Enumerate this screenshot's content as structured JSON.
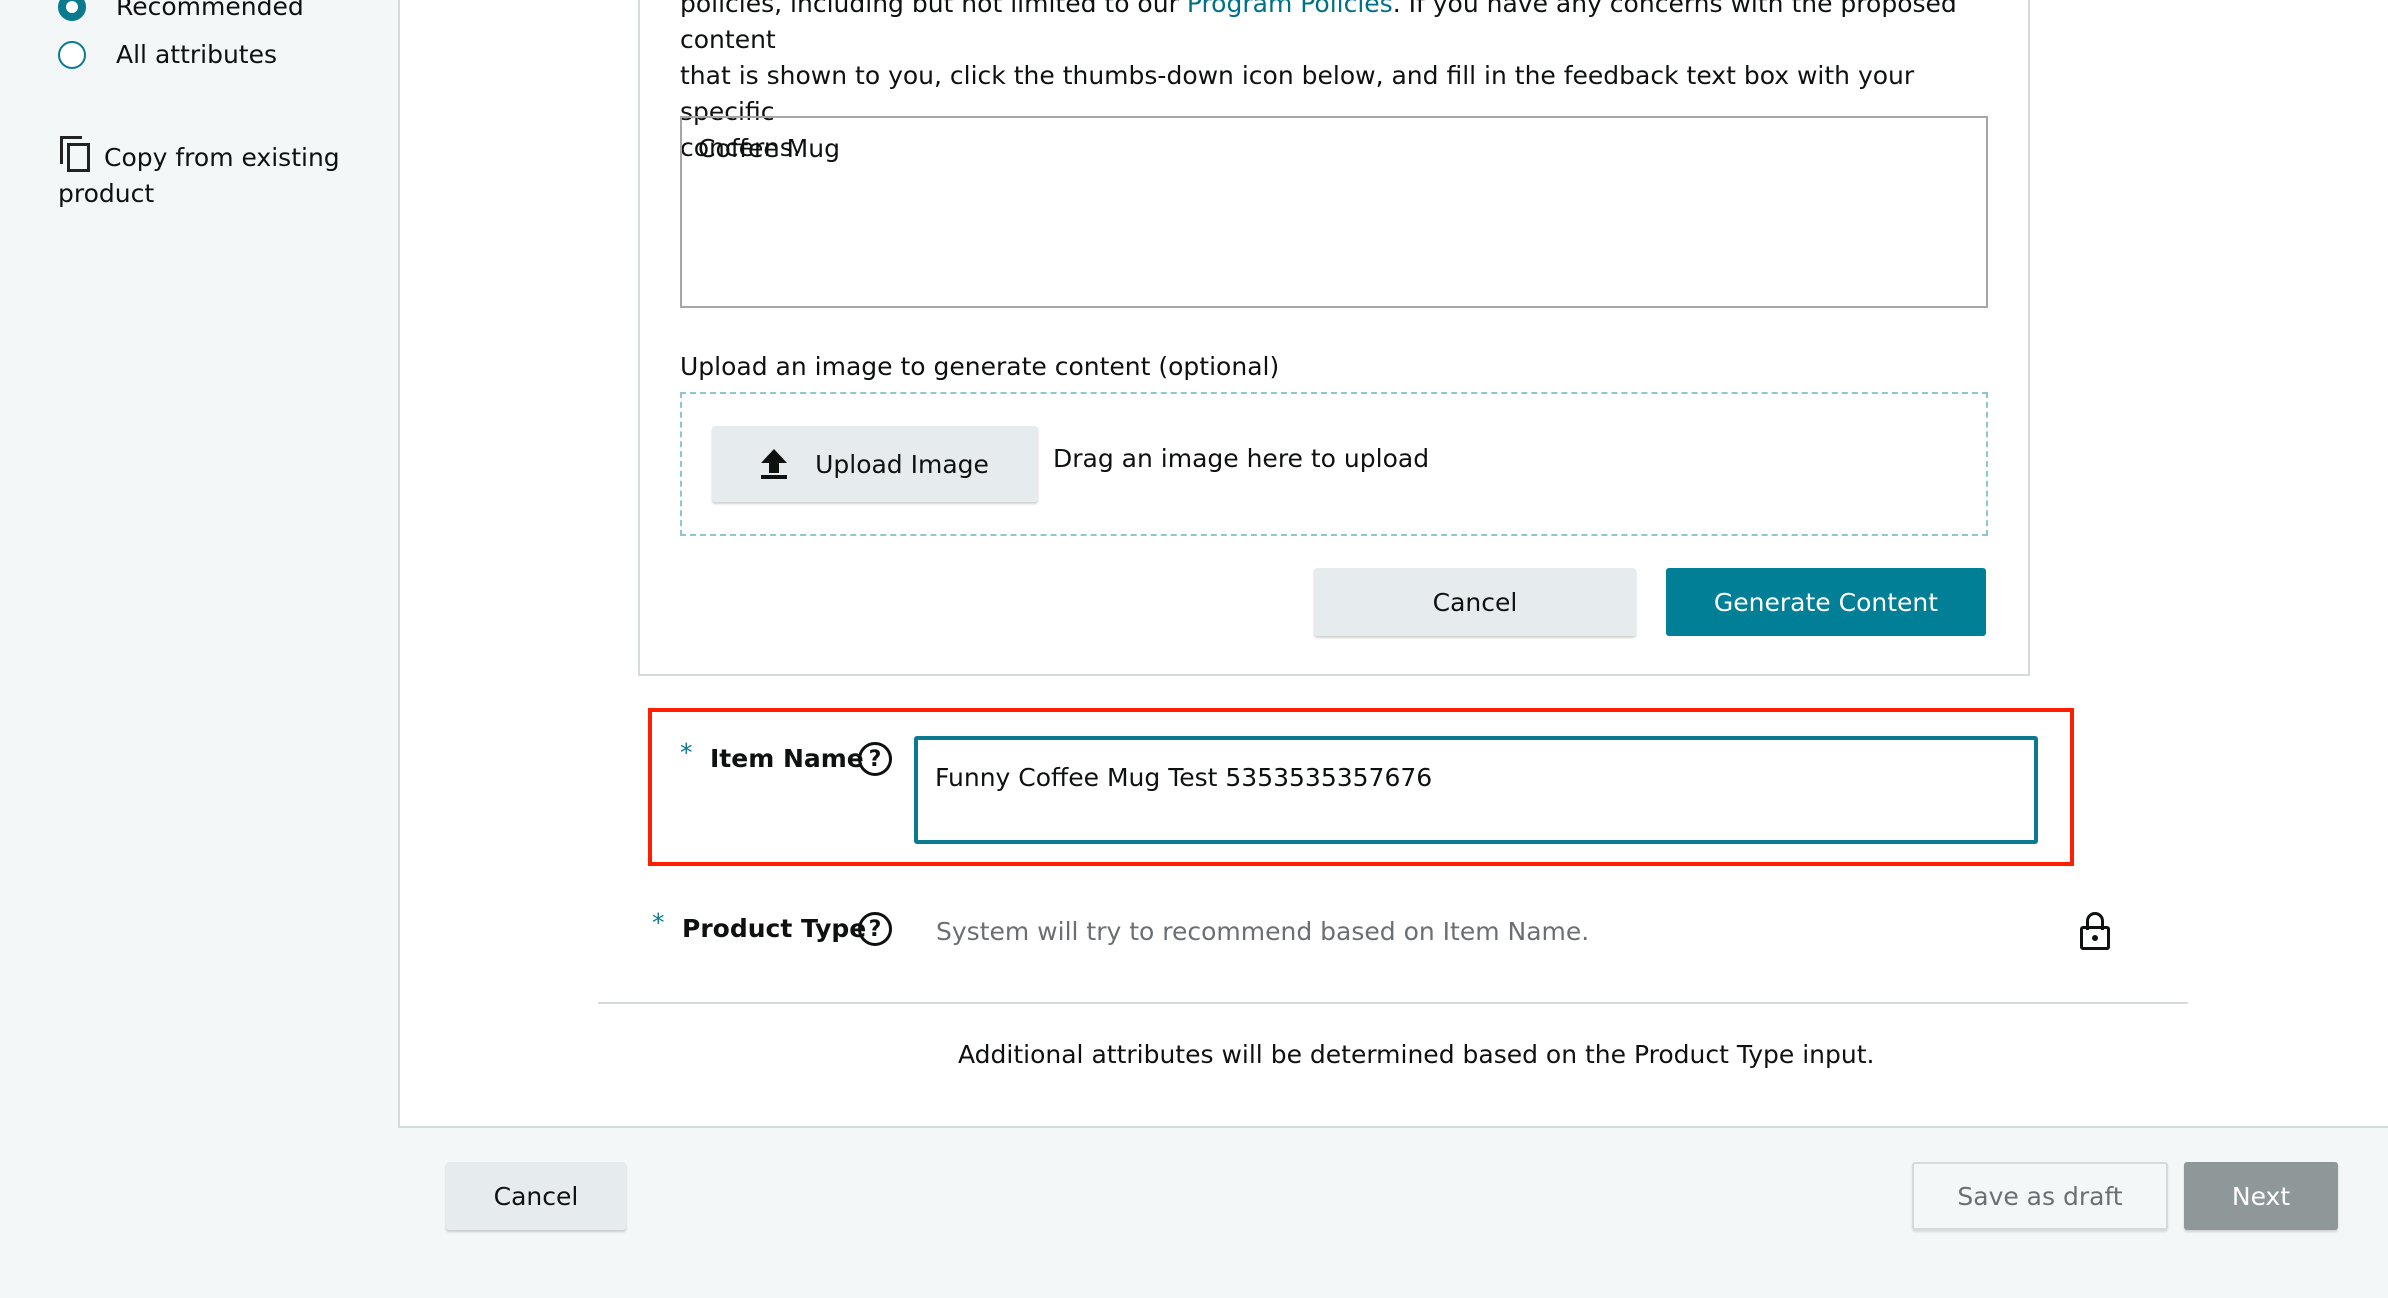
{
  "sidebar": {
    "view_options": [
      {
        "label": "Recommended",
        "checked": true
      },
      {
        "label": "All attributes",
        "checked": false
      }
    ],
    "copy_label": "Copy from existing product"
  },
  "ai_assistant": {
    "intro_line1": "policies, including but not limited to our ",
    "intro_link": "Program Policies",
    "intro_line1_end": ". If you have any concerns with the proposed content",
    "intro_line2": "that is shown to you, click the thumbs-down icon below, and fill in the feedback text box with your specific",
    "intro_line3": "concerns.",
    "prompt_value": "Coffee Mug",
    "upload_label": "Upload an image to generate content (optional)",
    "upload_button": "Upload Image",
    "drag_text": "Drag an image here to upload",
    "cancel_button": "Cancel",
    "generate_button": "Generate Content"
  },
  "form": {
    "required_marker": "*",
    "item_name_label": "Item Name",
    "item_name_value": "Funny Coffee Mug Test 5353535357676",
    "product_type_label": "Product Type",
    "product_type_placeholder": "System will try to recommend based on Item Name.",
    "help_glyph": "?",
    "additional_note": "Additional attributes will be determined based on the Product Type input."
  },
  "footer": {
    "cancel": "Cancel",
    "save_draft": "Save as draft",
    "next": "Next"
  },
  "colors": {
    "accent": "#007f96",
    "highlight": "#ff1f00",
    "disabled": "#8f9899"
  }
}
